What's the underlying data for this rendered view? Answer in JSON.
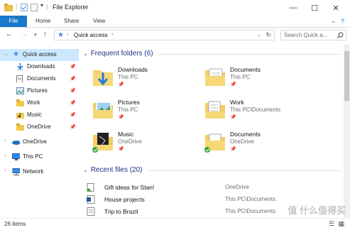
{
  "window": {
    "title": "File Explorer",
    "minimize": "—",
    "maximize": "☐",
    "close": "✕"
  },
  "ribbon": {
    "tabs": [
      "File",
      "Home",
      "Share",
      "View"
    ]
  },
  "address": {
    "path": "Quick access",
    "search_placeholder": "Search Quick a..."
  },
  "sidebar": {
    "quick_access": "Quick access",
    "items": [
      {
        "label": "Downloads",
        "icon": "download-icon"
      },
      {
        "label": "Documents",
        "icon": "documents-icon"
      },
      {
        "label": "Pictures",
        "icon": "pictures-icon"
      },
      {
        "label": "Work",
        "icon": "folder-icon"
      },
      {
        "label": "Music",
        "icon": "music-icon"
      },
      {
        "label": "OneDrive",
        "icon": "folder-icon"
      }
    ],
    "onedrive": "OneDrive",
    "thispc": "This PC",
    "network": "Network"
  },
  "frequent": {
    "header": "Frequent folders (6)",
    "folders": [
      {
        "name": "Downloads",
        "location": "This PC"
      },
      {
        "name": "Documents",
        "location": "This PC"
      },
      {
        "name": "Pictures",
        "location": "This PC"
      },
      {
        "name": "Work",
        "location": "This PC\\Documents"
      },
      {
        "name": "Music",
        "location": "OneDrive"
      },
      {
        "name": "Documents",
        "location": "OneDrive"
      }
    ]
  },
  "recent": {
    "header": "Recent files (20)",
    "files": [
      {
        "name": "Gift ideas for Stan!",
        "location": "OneDrive"
      },
      {
        "name": "House projects",
        "location": "This PC\\Documents"
      },
      {
        "name": "Trip to Brazil",
        "location": "This PC\\Documents"
      }
    ]
  },
  "status": {
    "items": "26 items"
  },
  "watermark": "值 什么值得买"
}
